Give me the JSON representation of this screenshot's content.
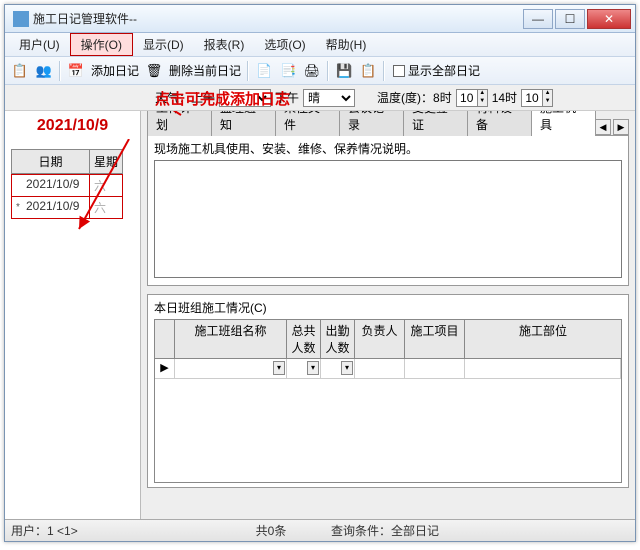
{
  "title": "施工日记管理软件--",
  "menu": [
    "用户(U)",
    "操作(O)",
    "显示(D)",
    "报表(R)",
    "选项(O)",
    "帮助(H)"
  ],
  "toolbar": {
    "add_diary": "添加日记",
    "delete_current": "删除当前日记",
    "show_all": "显示全部日记"
  },
  "weather": {
    "label": "天气：上午",
    "am_value": "",
    "pm_label": "下午",
    "pm_value": "晴",
    "temp_label": "温度(度)：8时",
    "t8": "10",
    "t14_label": "14时",
    "t14": "10"
  },
  "bigdate": "2021/10/9",
  "date_grid": {
    "headers": [
      "日期",
      "星期"
    ],
    "rows": [
      {
        "mark": "",
        "date": "2021/10/9",
        "day": "六"
      },
      {
        "mark": "*",
        "date": "2021/10/9",
        "day": "六"
      }
    ]
  },
  "tabs": [
    "工作计划",
    "监理通知",
    "来往文件",
    "会议记录",
    "变更签证",
    "材料设备",
    "施工机具"
  ],
  "panel1_title": "现场施工机具使用、安装、维修、保养情况说明。",
  "panel2_title": "本日班组施工情况(C)",
  "grid_headers": [
    "",
    "施工班组名称",
    "总共人数",
    "出勤人数",
    "负责人",
    "施工项目",
    "施工部位"
  ],
  "status": {
    "user": "用户：1 <1>",
    "count": "共0条",
    "filter": "查询条件：全部日记"
  },
  "annotation_text": "点击可完成添加日志"
}
